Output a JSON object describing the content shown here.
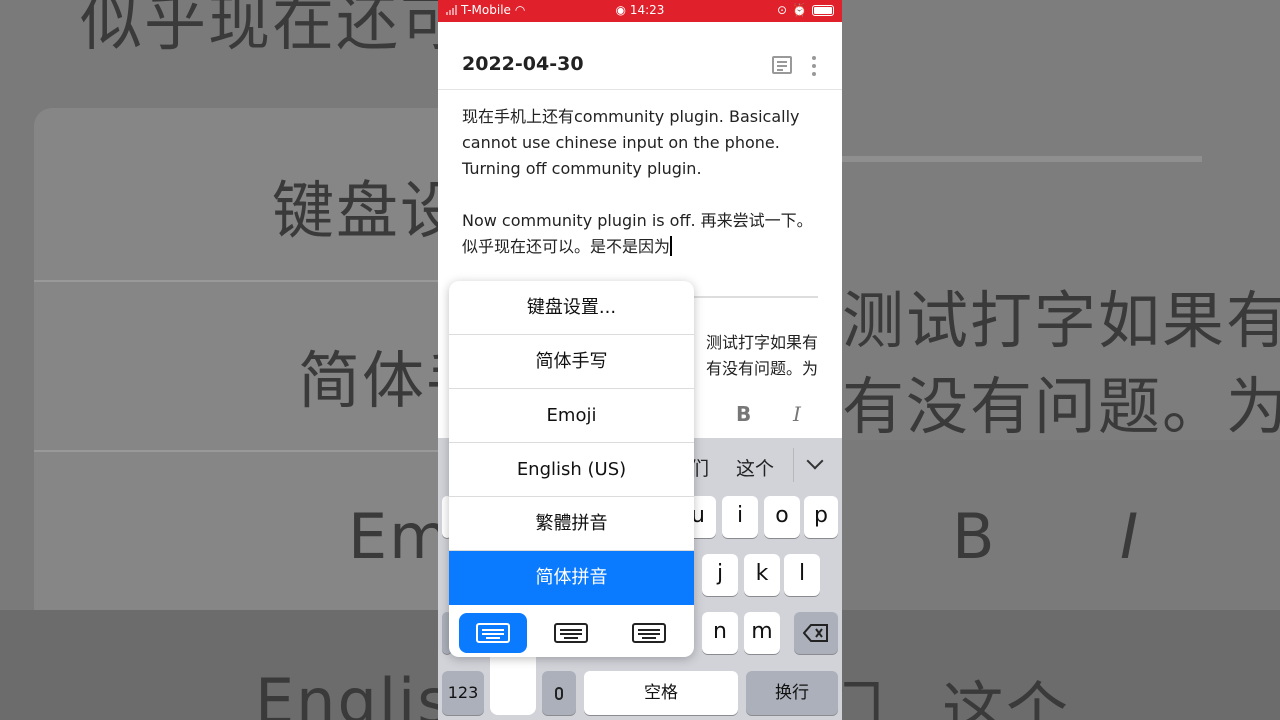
{
  "status_bar": {
    "carrier": "T-Mobile",
    "time": "14:23"
  },
  "note": {
    "title": "2022-04-30",
    "paragraph1": "现在手机上还有community plugin. Basically cannot use chinese input on the phone. Turning off community plugin.",
    "paragraph2": "Now community plugin is off. 再来尝试一下。似乎现在还可以。是不是因为",
    "paragraph3_line1": "测试打字如果有",
    "paragraph3_line2": "有没有问题。为"
  },
  "format_bar": {
    "bold": "B",
    "italic": "I"
  },
  "candidates": {
    "c1": "们",
    "c2": "这个"
  },
  "keyboard": {
    "row1": [
      "u",
      "i",
      "o",
      "p"
    ],
    "row2": [
      "j",
      "k",
      "l"
    ],
    "row3": [
      "n",
      "m"
    ],
    "numbers": "123",
    "space": "空格",
    "return": "换行"
  },
  "keyboard_menu": {
    "items": [
      "键盘设置...",
      "简体手写",
      "Emoji",
      "English (US)",
      "繁體拼音",
      "简体拼音"
    ],
    "selected_index": 5
  },
  "background": {
    "left_top": "似乎现在还可以",
    "left_mid": "键盘设",
    "left_line": "简体手",
    "left_emoji": "Em",
    "left_english": "English",
    "right_top": "测试打字如果有",
    "right_mid": "有没有问题。为",
    "right_b": "B",
    "right_i": "I",
    "right_c1": "门",
    "right_c2": "这个"
  },
  "colors": {
    "status_bar": "#e0202a",
    "accent": "#0a7aff",
    "keyboard_bg": "#d1d3d9"
  }
}
